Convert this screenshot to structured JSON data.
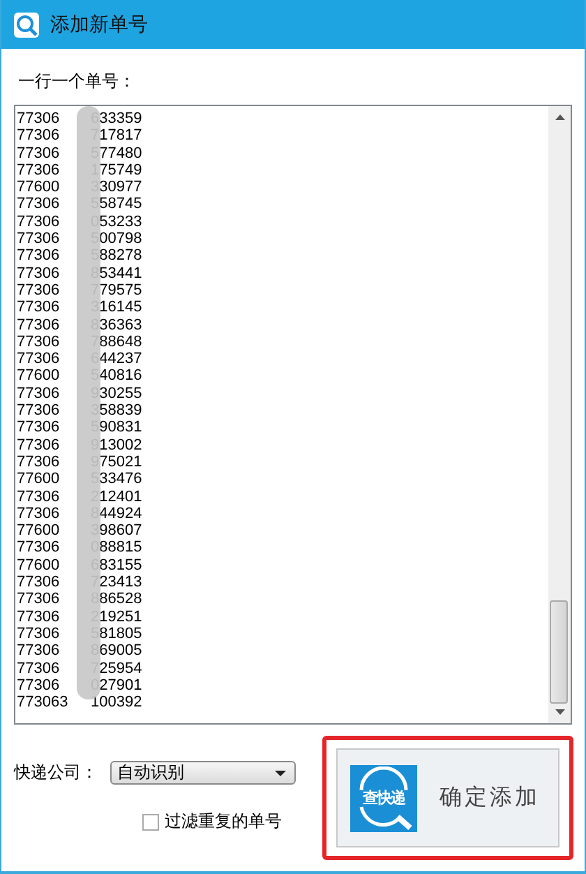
{
  "window": {
    "title": "添加新单号"
  },
  "list_label": "一行一个单号：",
  "tracking_numbers": [
    {
      "start": "77306",
      "end": "633359"
    },
    {
      "start": "77306",
      "end": "717817"
    },
    {
      "start": "77306",
      "end": "577480"
    },
    {
      "start": "77306",
      "end": "175749"
    },
    {
      "start": "77600",
      "end": "330977"
    },
    {
      "start": "77306",
      "end": "558745"
    },
    {
      "start": "77306",
      "end": "053233"
    },
    {
      "start": "77306",
      "end": "500798"
    },
    {
      "start": "77306",
      "end": "588278"
    },
    {
      "start": "77306",
      "end": "853441"
    },
    {
      "start": "77306",
      "end": "779575"
    },
    {
      "start": "77306",
      "end": "316145"
    },
    {
      "start": "77306",
      "end": "836363"
    },
    {
      "start": "77306",
      "end": "788648"
    },
    {
      "start": "77306",
      "end": "644237"
    },
    {
      "start": "77600",
      "end": "540816"
    },
    {
      "start": "77306",
      "end": "930255"
    },
    {
      "start": "77306",
      "end": "358839"
    },
    {
      "start": "77306",
      "end": "590831"
    },
    {
      "start": "77306",
      "end": "913002"
    },
    {
      "start": "77306",
      "end": "975021"
    },
    {
      "start": "77600",
      "end": "533476"
    },
    {
      "start": "77306",
      "end": "212401"
    },
    {
      "start": "77306",
      "end": "844924"
    },
    {
      "start": "77600",
      "end": "398607"
    },
    {
      "start": "77306",
      "end": "088815"
    },
    {
      "start": "77600",
      "end": "683155"
    },
    {
      "start": "77306",
      "end": "723413"
    },
    {
      "start": "77306",
      "end": "886528"
    },
    {
      "start": "77306",
      "end": "219251"
    },
    {
      "start": "77306",
      "end": "581805"
    },
    {
      "start": "77306",
      "end": "869005"
    },
    {
      "start": "77306",
      "end": "725954"
    },
    {
      "start": "77306",
      "end": "027901"
    },
    {
      "start": "773063",
      "end": "100392"
    }
  ],
  "company": {
    "label": "快递公司：",
    "value": "自动识别"
  },
  "filter_duplicates": {
    "label": "过滤重复的单号",
    "checked": false
  },
  "confirm_button": {
    "logo_text": "查快递",
    "label": "确定添加",
    "highlighted": true
  }
}
